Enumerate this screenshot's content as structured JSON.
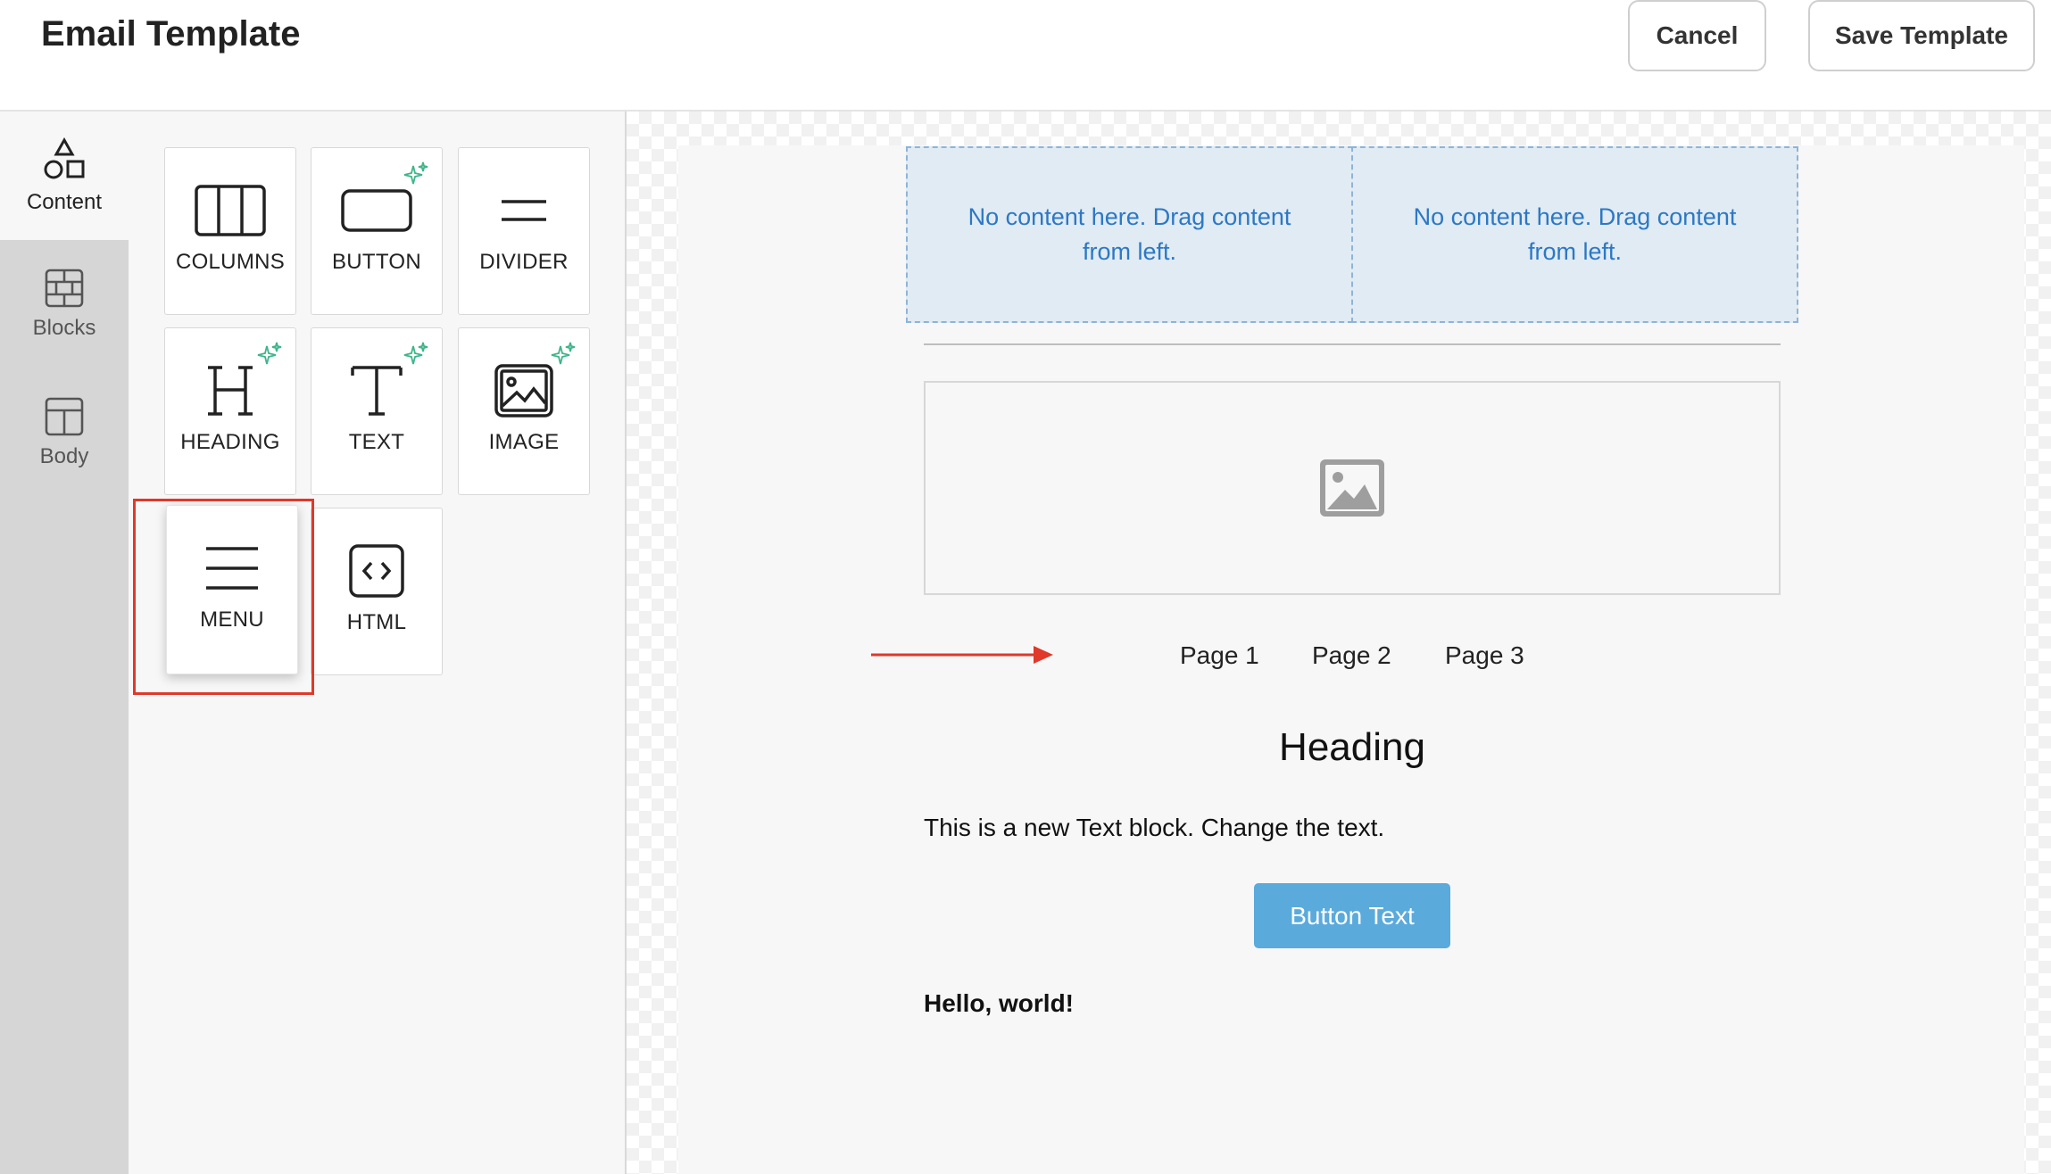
{
  "header": {
    "title": "Email Template",
    "cancel_label": "Cancel",
    "save_label": "Save Template"
  },
  "rail": [
    {
      "label": "Content",
      "icon": "shapes-icon",
      "active": true
    },
    {
      "label": "Blocks",
      "icon": "blocks-icon"
    },
    {
      "label": "Body",
      "icon": "layout-icon"
    }
  ],
  "tools": [
    {
      "label": "COLUMNS",
      "icon": "columns-icon"
    },
    {
      "label": "BUTTON",
      "icon": "button-icon",
      "ai": true
    },
    {
      "label": "DIVIDER",
      "icon": "divider-icon"
    },
    {
      "label": "HEADING",
      "icon": "heading-icon",
      "ai": true
    },
    {
      "label": "TEXT",
      "icon": "text-icon",
      "ai": true
    },
    {
      "label": "IMAGE",
      "icon": "image-icon",
      "ai": true
    },
    {
      "label": "MENU",
      "icon": "menu-icon",
      "highlighted": true
    },
    {
      "label": "HTML",
      "icon": "code-icon"
    }
  ],
  "canvas": {
    "columns": [
      {
        "placeholder": "No content here. Drag content from left."
      },
      {
        "placeholder": "No content here. Drag content from left."
      }
    ],
    "menu_links": [
      "Page 1",
      "Page 2",
      "Page 3"
    ],
    "heading": "Heading",
    "text": "This is a new Text block. Change the text.",
    "button_label": "Button Text",
    "hello": "Hello, world!"
  },
  "colors": {
    "accent_blue": "#5aaadc",
    "column_fill": "#e0ebf4",
    "column_text": "#2d78c4",
    "highlight": "#e0382a",
    "sparkle": "#3fb58a",
    "rail_bg": "#d6d6d6",
    "panel_bg": "#f7f7f7"
  }
}
